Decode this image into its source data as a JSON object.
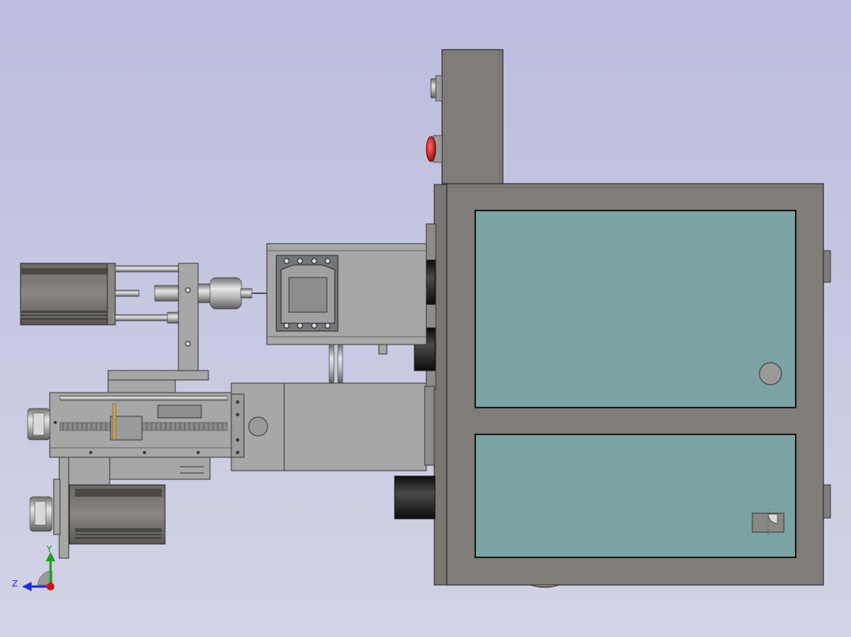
{
  "viewport": {
    "background_top": "#bcbddf",
    "background_bottom": "#d2d3e4"
  },
  "colors": {
    "housing": "#807d79",
    "housing_dark": "#6c6965",
    "panel": "#7ca3a3",
    "part_light": "#a7a7a7",
    "part_mid": "#9a9a9a",
    "motor_black": "#1e1e1e",
    "button_red": "#c4161b"
  },
  "triad": {
    "y_label": "Y",
    "z_label": "Z",
    "y_color": "#1ea01e",
    "z_color": "#2030d0",
    "x_color": "#d01818"
  },
  "model": {
    "icons": [
      "stepper-motor-icon",
      "control-box-icon",
      "emergency-stop-icon",
      "axis-triad-icon"
    ]
  }
}
